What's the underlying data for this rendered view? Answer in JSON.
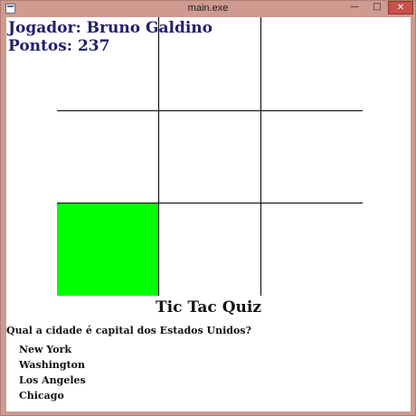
{
  "window": {
    "title": "main.exe",
    "controls": {
      "minimize": "—",
      "maximize": "□",
      "close": "✕"
    }
  },
  "player": {
    "name_line": "Jogador: Bruno Galdino",
    "score_line": "Pontos: 237"
  },
  "board": {
    "rows": 3,
    "cols": 3,
    "fill_color": "#00ff00",
    "cells": [
      [
        "",
        "",
        ""
      ],
      [
        "",
        "",
        ""
      ],
      [
        "filled",
        "",
        ""
      ]
    ]
  },
  "game_title": "Tic Tac Quiz",
  "quiz": {
    "question": "Qual a cidade é capital dos Estados Unidos?",
    "options": [
      "New York",
      "Washington",
      "Los Angeles",
      "Chicago"
    ]
  }
}
